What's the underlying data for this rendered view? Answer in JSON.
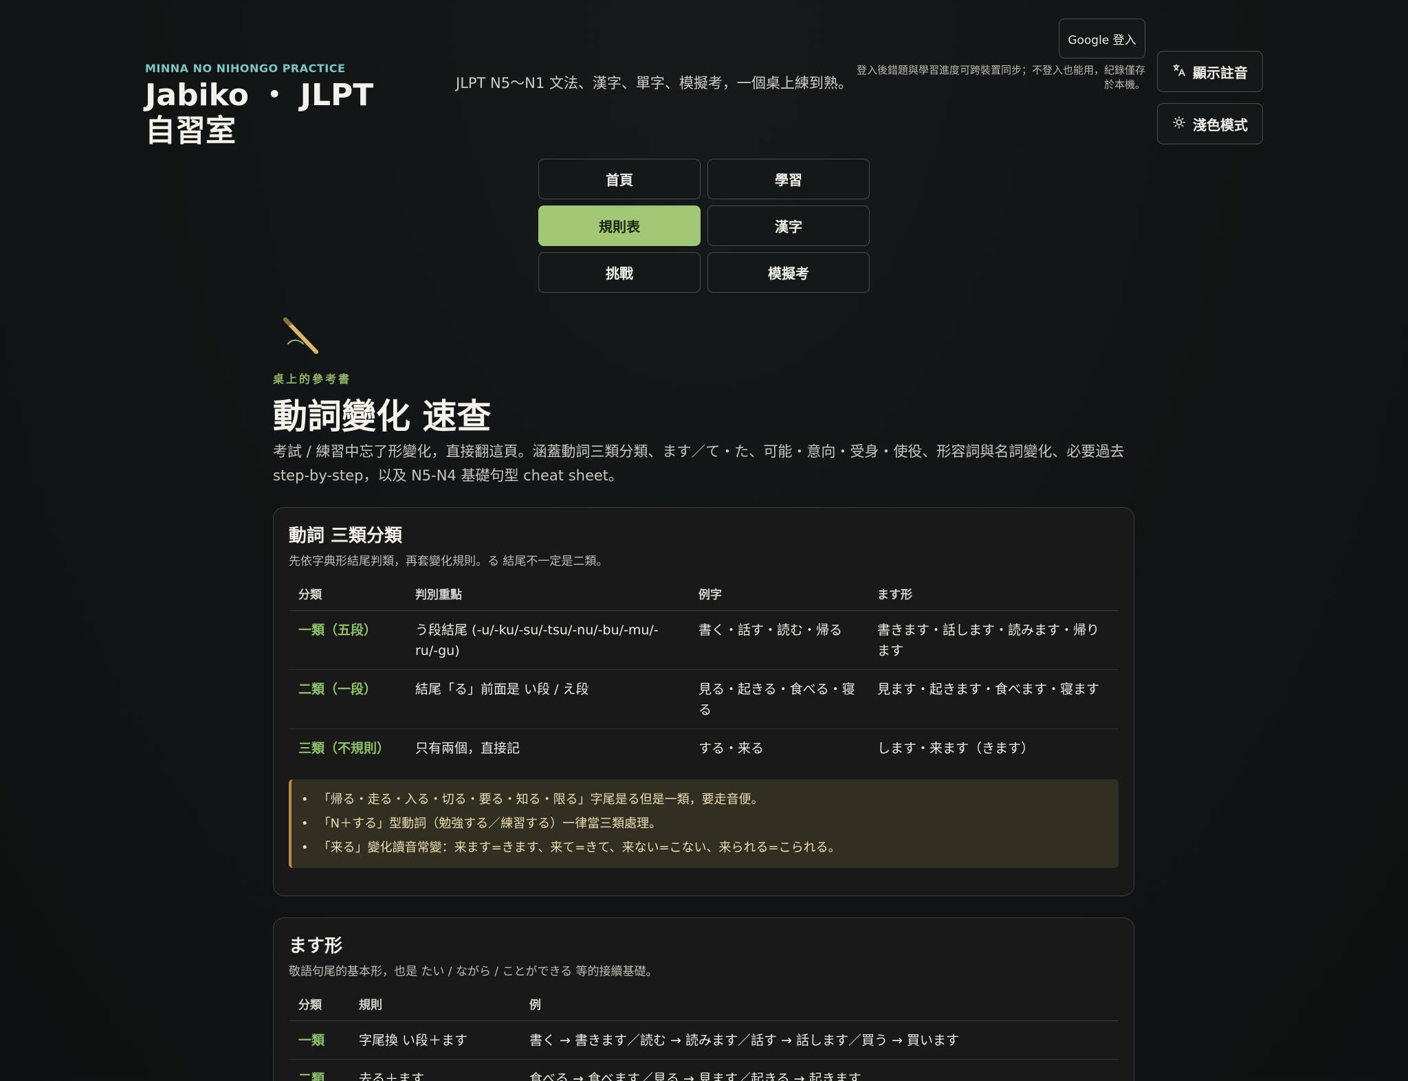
{
  "header": {
    "eyebrow": "MINNA NO NIHONGO PRACTICE",
    "title": "Jabiko ・ JLPT 自習室",
    "tagline": "JLPT N5〜N1 文法、漢字、單字、模擬考，一個桌上練到熟。",
    "login_label": "Google 登入",
    "sync_note": "登入後錯題與學習進度可跨裝置同步；不登入也能用，紀錄僅存於本機。",
    "furigana_label": "顯示註音",
    "light_mode_label": "淺色模式"
  },
  "nav": {
    "items": [
      {
        "label": "首頁"
      },
      {
        "label": "學習"
      },
      {
        "label": "規則表",
        "active": true
      },
      {
        "label": "漢字"
      },
      {
        "label": "挑戰"
      },
      {
        "label": "模擬考"
      }
    ]
  },
  "hero": {
    "eyebrow": "桌上的參考書",
    "title": "動詞變化 速查",
    "intro": "考試 / 練習中忘了形變化，直接翻這頁。涵蓋動詞三類分類、ます／て・た、可能・意向・受身・使役、形容詞與名詞變化、必要過去 step-by-step，以及 N5-N4 基礎句型 cheat sheet。"
  },
  "types_card": {
    "title": "動詞 三類分類",
    "subtitle": "先依字典形結尾判類，再套變化規則。る 結尾不一定是二類。",
    "headers": [
      "分類",
      "判別重點",
      "例字",
      "ます形"
    ],
    "rows": [
      {
        "cat": "一類（五段）",
        "rule": "う段結尾 (-u/-ku/-su/-tsu/-nu/-bu/-mu/-ru/-gu)",
        "examples": "書く・話す・読む・帰る",
        "masu": "書きます・話します・読みます・帰ります"
      },
      {
        "cat": "二類（一段）",
        "rule": "結尾「る」前面是 い段 / え段",
        "examples": "見る・起きる・食べる・寝る",
        "masu": "見ます・起きます・食べます・寝ます"
      },
      {
        "cat": "三類（不規則）",
        "rule": "只有兩個，直接記",
        "examples": "する・来る",
        "masu": "します・来ます（きます）"
      }
    ],
    "tips": [
      "「帰る・走る・入る・切る・要る・知る・限る」字尾是る但是一類，要走音便。",
      "「N＋する」型動詞（勉強する／練習する）一律當三類處理。",
      "「来る」變化讀音常變：来ます=きます、来て=きて、来ない=こない、来られる=こられる。"
    ]
  },
  "masu_card": {
    "title": "ます形",
    "subtitle": "敬語句尾的基本形，也是 たい / ながら / ことができる 等的接續基礎。",
    "headers": [
      "分類",
      "規則",
      "例"
    ],
    "rows": [
      {
        "cat": "一類",
        "rule": "字尾換 い段＋ます",
        "example": "書く → 書きます／読む → 読みます／話す → 話します／買う → 買います"
      },
      {
        "cat": "二類",
        "rule": "去る＋ます",
        "example": "食べる → 食べます／見る → 見ます／起きる → 起きます"
      }
    ]
  },
  "colors": {
    "accent": "#a3c875",
    "category_text": "#8fbf6a",
    "brand_eyebrow": "#7fc4c4",
    "tip_border": "#b8904a",
    "background": "#111414"
  },
  "icons": {
    "translate": "translate-icon",
    "sun": "sun-icon",
    "brush": "brush-icon"
  }
}
